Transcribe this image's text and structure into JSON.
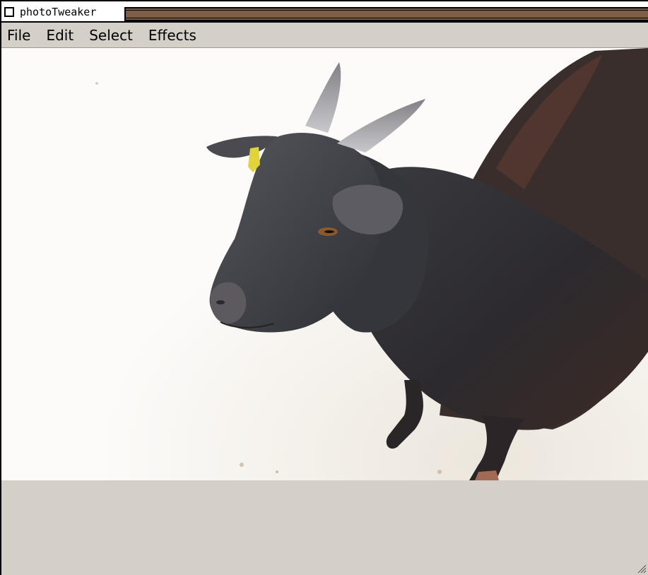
{
  "window": {
    "title": "photoTweaker",
    "titlebar_color": "#7d5f48"
  },
  "menu": {
    "items": [
      {
        "label": "File"
      },
      {
        "label": "Edit"
      },
      {
        "label": "Select"
      },
      {
        "label": "Effects"
      }
    ]
  },
  "canvas": {
    "subject": "black goat photo",
    "background_color": "#fbfaf8"
  },
  "icons": {
    "close": "close-box-icon",
    "resize": "resize-grip-icon"
  }
}
